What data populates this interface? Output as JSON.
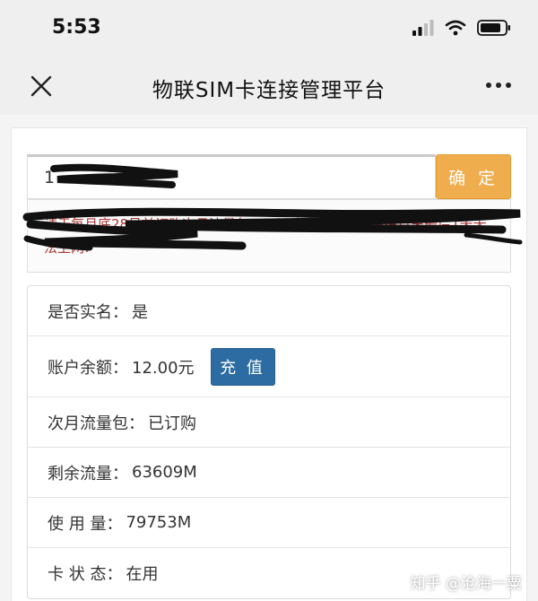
{
  "status_bar": {
    "time": "5:53"
  },
  "nav": {
    "title": "物联SIM卡连接管理平台"
  },
  "search": {
    "value": "1",
    "confirm_label": "确 定"
  },
  "notice": {
    "text": "请于每月底28号前订购次月流量包，不订购次月流量包将在月末最后1天无法上网!"
  },
  "info": {
    "realname": {
      "label": "是否实名：",
      "value": "是"
    },
    "balance": {
      "label": "账户余额：",
      "value": "12.00元",
      "recharge_label": "充 值"
    },
    "next_month": {
      "label": "次月流量包：",
      "value": "已订购"
    },
    "remaining": {
      "label": "剩余流量：",
      "value": "63609M"
    },
    "used": {
      "label": "使 用 量：",
      "value": "79753M"
    },
    "card_status": {
      "label": "卡 状 态：",
      "value": "在用"
    }
  },
  "watermark": "知乎 @沧海一粟",
  "colors": {
    "confirm": "#f0ad4e",
    "recharge": "#2d6ca2",
    "notice_text": "#a33333"
  }
}
